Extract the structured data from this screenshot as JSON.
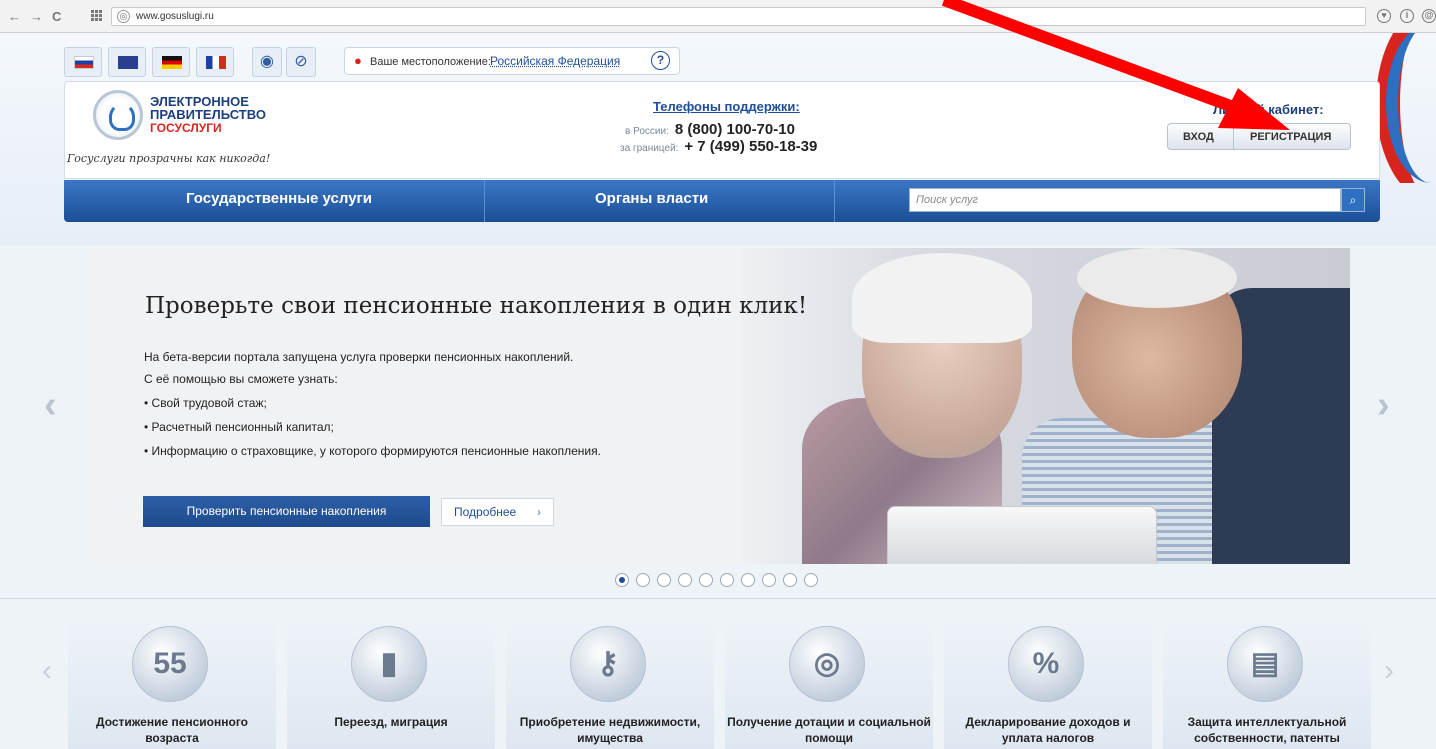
{
  "browser": {
    "url": "www.gosuslugi.ru",
    "back_icon": "back-arrow-icon",
    "forward_icon": "forward-arrow-icon",
    "reload_icon": "reload-icon",
    "apps_icon": "apps-grid-icon"
  },
  "header": {
    "location_label": "Ваше местоположение:",
    "location_value": "Российская Федерация",
    "location_help": "?",
    "logo_line1": "ЭЛЕКТРОННОЕ",
    "logo_line2": "ПРАВИТЕЛЬСТВО",
    "logo_line3": "ГОСУСЛУГИ",
    "tagline": "Госуслуги прозрачны как никогда!",
    "support_title": "Телефоны поддержки:",
    "phone_russia_label": "в России:",
    "phone_russia": "8 (800) 100-70-10",
    "phone_abroad_label": "за границей:",
    "phone_abroad": "+ 7 (499) 550-18-39",
    "cabinet_title": "Личный кабинет:",
    "login_label": "ВХОД",
    "register_label": "РЕГИСТРАЦИЯ"
  },
  "nav": {
    "item1": "Государственные услуги",
    "item2": "Органы власти",
    "search_placeholder": "Поиск услуг"
  },
  "banner": {
    "title": "Проверьте свои пенсионные накопления в один клик!",
    "line1": "На бета-версии портала запущена услуга проверки пенсионных накоплений.",
    "line2": "С её помощью вы сможете узнать:",
    "bullet1": "•  Свой трудовой стаж;",
    "bullet2": "•  Расчетный пенсионный капитал;",
    "bullet3": "•  Информацию о страховщике, у которого формируются пенсионные накопления.",
    "primary_button": "Проверить пенсионные накопления",
    "secondary_button": "Подробнее",
    "slide_count": 10,
    "active_slide": 1
  },
  "services": [
    {
      "label": "Достижение пенсионного возраста",
      "icon": "calendar-55-icon",
      "glyph": "55"
    },
    {
      "label": "Переезд, миграция",
      "icon": "passport-icon",
      "glyph": "▮"
    },
    {
      "label": "Приобретение недвижимости, имущества",
      "icon": "keys-icon",
      "glyph": "⚷"
    },
    {
      "label": "Получение дотации и социальной помощи",
      "icon": "lifebuoy-icon",
      "glyph": "◎"
    },
    {
      "label": "Декларирование доходов и уплата налогов",
      "icon": "percent-icon",
      "glyph": "%"
    },
    {
      "label": "Защита интеллектуальной собственности, патенты",
      "icon": "certificate-icon",
      "glyph": "▤"
    }
  ],
  "colors": {
    "nav_blue": "#1c4f97",
    "accent_red": "#d8241f",
    "link_blue": "#1d4f9c",
    "annotation": "#ff0000"
  }
}
